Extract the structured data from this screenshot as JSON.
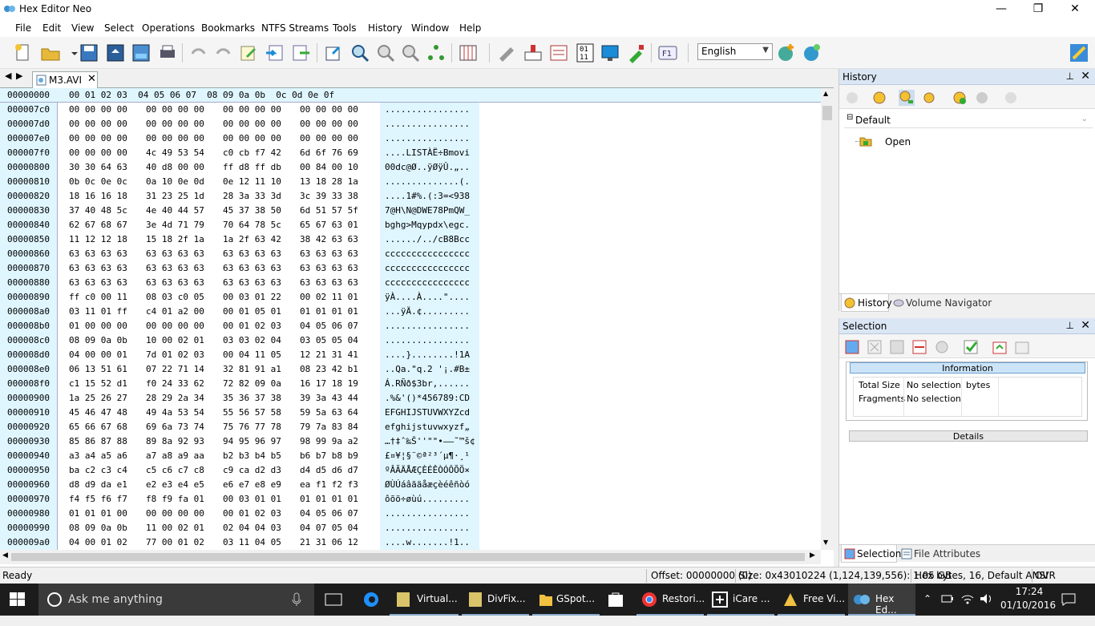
{
  "window": {
    "title": "Hex Editor Neo",
    "minimize": "—",
    "maximize": "❐",
    "close": "✕"
  },
  "menu": [
    "File",
    "Edit",
    "View",
    "Select",
    "Operations",
    "Bookmarks",
    "NTFS Streams",
    "Tools",
    "History",
    "Window",
    "Help"
  ],
  "toolbar": {
    "language": "English",
    "icons": [
      "new-file-icon",
      "open-file-icon",
      "open-dropdown-icon",
      "save-icon",
      "save-all-icon",
      "save-as-icon",
      "print-icon",
      "undo-icon",
      "redo-icon",
      "edit-icon",
      "import-icon",
      "export-icon",
      "copy-to-icon",
      "find-icon",
      "find-next-icon",
      "find-prev-icon",
      "structure-icon",
      "columns-icon",
      "bits-icon",
      "patterns-icon",
      "compare-icon",
      "binary-icon",
      "screen-icon",
      "tool-icon",
      "help-f1-icon",
      "globe-add-icon",
      "globe-icon",
      "colors-icon"
    ]
  },
  "editor": {
    "tab_label": "M3.AVI",
    "tab_close": "✕",
    "nav_left": "◀",
    "nav_right": "▶",
    "header_offset": "00000000",
    "header_cols": "00 01 02 03  04 05 06 07  08 09 0a 0b  0c 0d 0e 0f",
    "rows": [
      {
        "off": "000007c0",
        "hex": "00 00 00 00  00 00 00 00  00 00 00 00  00 00 00 00",
        "ascii": "................"
      },
      {
        "off": "000007d0",
        "hex": "00 00 00 00  00 00 00 00  00 00 00 00  00 00 00 00",
        "ascii": "................"
      },
      {
        "off": "000007e0",
        "hex": "00 00 00 00  00 00 00 00  00 00 00 00  00 00 00 00",
        "ascii": "................"
      },
      {
        "off": "000007f0",
        "hex": "00 00 00 00  4c 49 53 54  c0 cb f7 42  6d 6f 76 69",
        "ascii": "....LISTÀË÷Bmovi"
      },
      {
        "off": "00000800",
        "hex": "30 30 64 63  40 d8 00 00  ff d8 ff db  00 84 00 10",
        "ascii": "00dc@Ø..ÿØÿÛ.„.."
      },
      {
        "off": "00000810",
        "hex": "0b 0c 0e 0c  0a 10 0e 0d  0e 12 11 10  13 18 28 1a",
        "ascii": "..............(."
      },
      {
        "off": "00000820",
        "hex": "18 16 16 18  31 23 25 1d  28 3a 33 3d  3c 39 33 38",
        "ascii": "....1#%.(:3=<938"
      },
      {
        "off": "00000830",
        "hex": "37 40 48 5c  4e 40 44 57  45 37 38 50  6d 51 57 5f",
        "ascii": "7@H\\N@DWE78PmQW_"
      },
      {
        "off": "00000840",
        "hex": "62 67 68 67  3e 4d 71 79  70 64 78 5c  65 67 63 01",
        "ascii": "bghg>Mqypdx\\egc."
      },
      {
        "off": "00000850",
        "hex": "11 12 12 18  15 18 2f 1a  1a 2f 63 42  38 42 63 63",
        "ascii": "....../../cB8Bcc"
      },
      {
        "off": "00000860",
        "hex": "63 63 63 63  63 63 63 63  63 63 63 63  63 63 63 63",
        "ascii": "cccccccccccccccc"
      },
      {
        "off": "00000870",
        "hex": "63 63 63 63  63 63 63 63  63 63 63 63  63 63 63 63",
        "ascii": "cccccccccccccccc"
      },
      {
        "off": "00000880",
        "hex": "63 63 63 63  63 63 63 63  63 63 63 63  63 63 63 63",
        "ascii": "cccccccccccccccc"
      },
      {
        "off": "00000890",
        "hex": "ff c0 00 11  08 03 c0 05  00 03 01 22  00 02 11 01",
        "ascii": "ÿÀ....À....\"...."
      },
      {
        "off": "000008a0",
        "hex": "03 11 01 ff  c4 01 a2 00  00 01 05 01  01 01 01 01",
        "ascii": "...ÿÄ.¢........."
      },
      {
        "off": "000008b0",
        "hex": "01 00 00 00  00 00 00 00  00 01 02 03  04 05 06 07",
        "ascii": "................"
      },
      {
        "off": "000008c0",
        "hex": "08 09 0a 0b  10 00 02 01  03 03 02 04  03 05 05 04",
        "ascii": "................"
      },
      {
        "off": "000008d0",
        "hex": "04 00 00 01  7d 01 02 03  00 04 11 05  12 21 31 41",
        "ascii": "....}........!1A"
      },
      {
        "off": "000008e0",
        "hex": "06 13 51 61  07 22 71 14  32 81 91 a1  08 23 42 b1",
        "ascii": "..Qa.\"q.2 '¡.#B±"
      },
      {
        "off": "000008f0",
        "hex": "c1 15 52 d1  f0 24 33 62  72 82 09 0a  16 17 18 19",
        "ascii": "Á.RÑð$3br,......"
      },
      {
        "off": "00000900",
        "hex": "1a 25 26 27  28 29 2a 34  35 36 37 38  39 3a 43 44",
        "ascii": ".%&'()*456789:CD"
      },
      {
        "off": "00000910",
        "hex": "45 46 47 48  49 4a 53 54  55 56 57 58  59 5a 63 64",
        "ascii": "EFGHIJSTUVWXYZcd"
      },
      {
        "off": "00000920",
        "hex": "65 66 67 68  69 6a 73 74  75 76 77 78  79 7a 83 84",
        "ascii": "efghijstuvwxyzf„"
      },
      {
        "off": "00000930",
        "hex": "85 86 87 88  89 8a 92 93  94 95 96 97  98 99 9a a2",
        "ascii": "…†‡ˆ‰Š''\"\"•–—˜™š¢"
      },
      {
        "off": "00000940",
        "hex": "a3 a4 a5 a6  a7 a8 a9 aa  b2 b3 b4 b5  b6 b7 b8 b9",
        "ascii": "£¤¥¦§¨©ª²³´µ¶·¸¹"
      },
      {
        "off": "00000950",
        "hex": "ba c2 c3 c4  c5 c6 c7 c8  c9 ca d2 d3  d4 d5 d6 d7",
        "ascii": "ºÂÃÄÅÆÇÈÉÊÒÓÔÕÖ×"
      },
      {
        "off": "00000960",
        "hex": "d8 d9 da e1  e2 e3 e4 e5  e6 e7 e8 e9  ea f1 f2 f3",
        "ascii": "ØÙÚáâãäåæçèéêñòó"
      },
      {
        "off": "00000970",
        "hex": "f4 f5 f6 f7  f8 f9 fa 01  00 03 01 01  01 01 01 01",
        "ascii": "ôõö÷øùú........."
      },
      {
        "off": "00000980",
        "hex": "01 01 01 00  00 00 00 00  00 01 02 03  04 05 06 07",
        "ascii": "................"
      },
      {
        "off": "00000990",
        "hex": "08 09 0a 0b  11 00 02 01  02 04 04 03  04 07 05 04",
        "ascii": "................"
      },
      {
        "off": "000009a0",
        "hex": "04 00 01 02  77 00 01 02  03 11 04 05  21 31 06 12",
        "ascii": "....w.......!1.."
      }
    ]
  },
  "history_panel": {
    "title": "History",
    "pin": "📌",
    "close": "✕",
    "group_label": "Default",
    "item_label": "Open",
    "tab_history": "History",
    "tab_volume": "Volume Navigator"
  },
  "selection_panel": {
    "title": "Selection",
    "info_header": "Information",
    "rows": [
      {
        "k": "Total Size",
        "v": "No selection",
        "u": "bytes"
      },
      {
        "k": "Fragments",
        "v": "No selection",
        "u": ""
      }
    ],
    "details_header": "Details",
    "tab_selection": "Selection",
    "tab_file_attributes": "File Attributes"
  },
  "statusbar": {
    "ready": "Ready",
    "offset": "Offset: 00000000 (0)",
    "size": "Size: 0x43010224 (1,124,139,556): 1.05 GB",
    "mode": "Hex bytes, 16, Default ANSI",
    "ovr": "OVR"
  },
  "taskbar": {
    "search_placeholder": "Ask me anything",
    "apps": [
      "Virtual...",
      "DivFix...",
      "GSpot...",
      "",
      "Restori...",
      "iCare ...",
      "Free Vi...",
      "Hex Ed..."
    ],
    "time": "17:24",
    "date": "01/10/2016"
  },
  "colors": {
    "hex_bg": "#dff6ff",
    "accent": "#0078d7",
    "panel_title": "#dbe6f4"
  }
}
